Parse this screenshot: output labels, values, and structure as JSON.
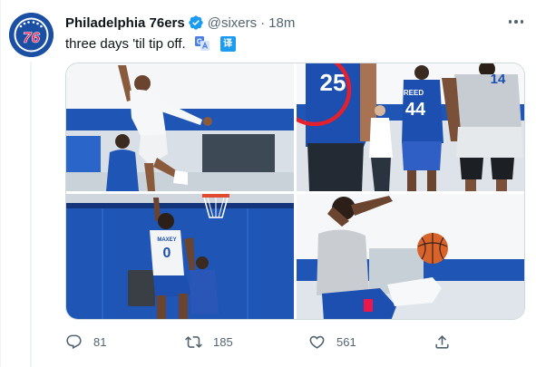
{
  "tweet": {
    "display_name": "Philadelphia 76ers",
    "verified": true,
    "handle": "@sixers",
    "separator": "·",
    "time": "18m",
    "text": "three days 'til tip off.",
    "translate_glyph": "译"
  },
  "avatar": {
    "logo_text": "76",
    "brand_colors": {
      "blue": "#1a4fa3",
      "red": "#ed174c",
      "white": "#ffffff"
    }
  },
  "media": {
    "photos": [
      {
        "name": "photo-dunk-drill"
      },
      {
        "name": "photo-team-jerseys",
        "jerseys": [
          "25",
          "44",
          "14"
        ],
        "jersey_names": [
          "REED"
        ],
        "annotation": "red-circle-around-25"
      },
      {
        "name": "photo-maxey-layup",
        "jersey_number": "0",
        "jersey_name": "MAXEY"
      },
      {
        "name": "photo-dunk-closeup"
      }
    ]
  },
  "actions": {
    "reply_count": "81",
    "retweet_count": "185",
    "like_count": "561"
  },
  "icons": {
    "avatar": "sixers-logo-icon",
    "verified": "verified-badge-icon",
    "more": "more-options-icon",
    "translate": "translate-icon",
    "reply": "reply-icon",
    "retweet": "retweet-icon",
    "like": "heart-icon",
    "share": "share-icon"
  },
  "colors": {
    "text_primary": "#0f1419",
    "text_secondary": "#536471",
    "accent": "#1d9bf0",
    "border": "#cfd9de",
    "annotation_red": "#e5202e"
  }
}
